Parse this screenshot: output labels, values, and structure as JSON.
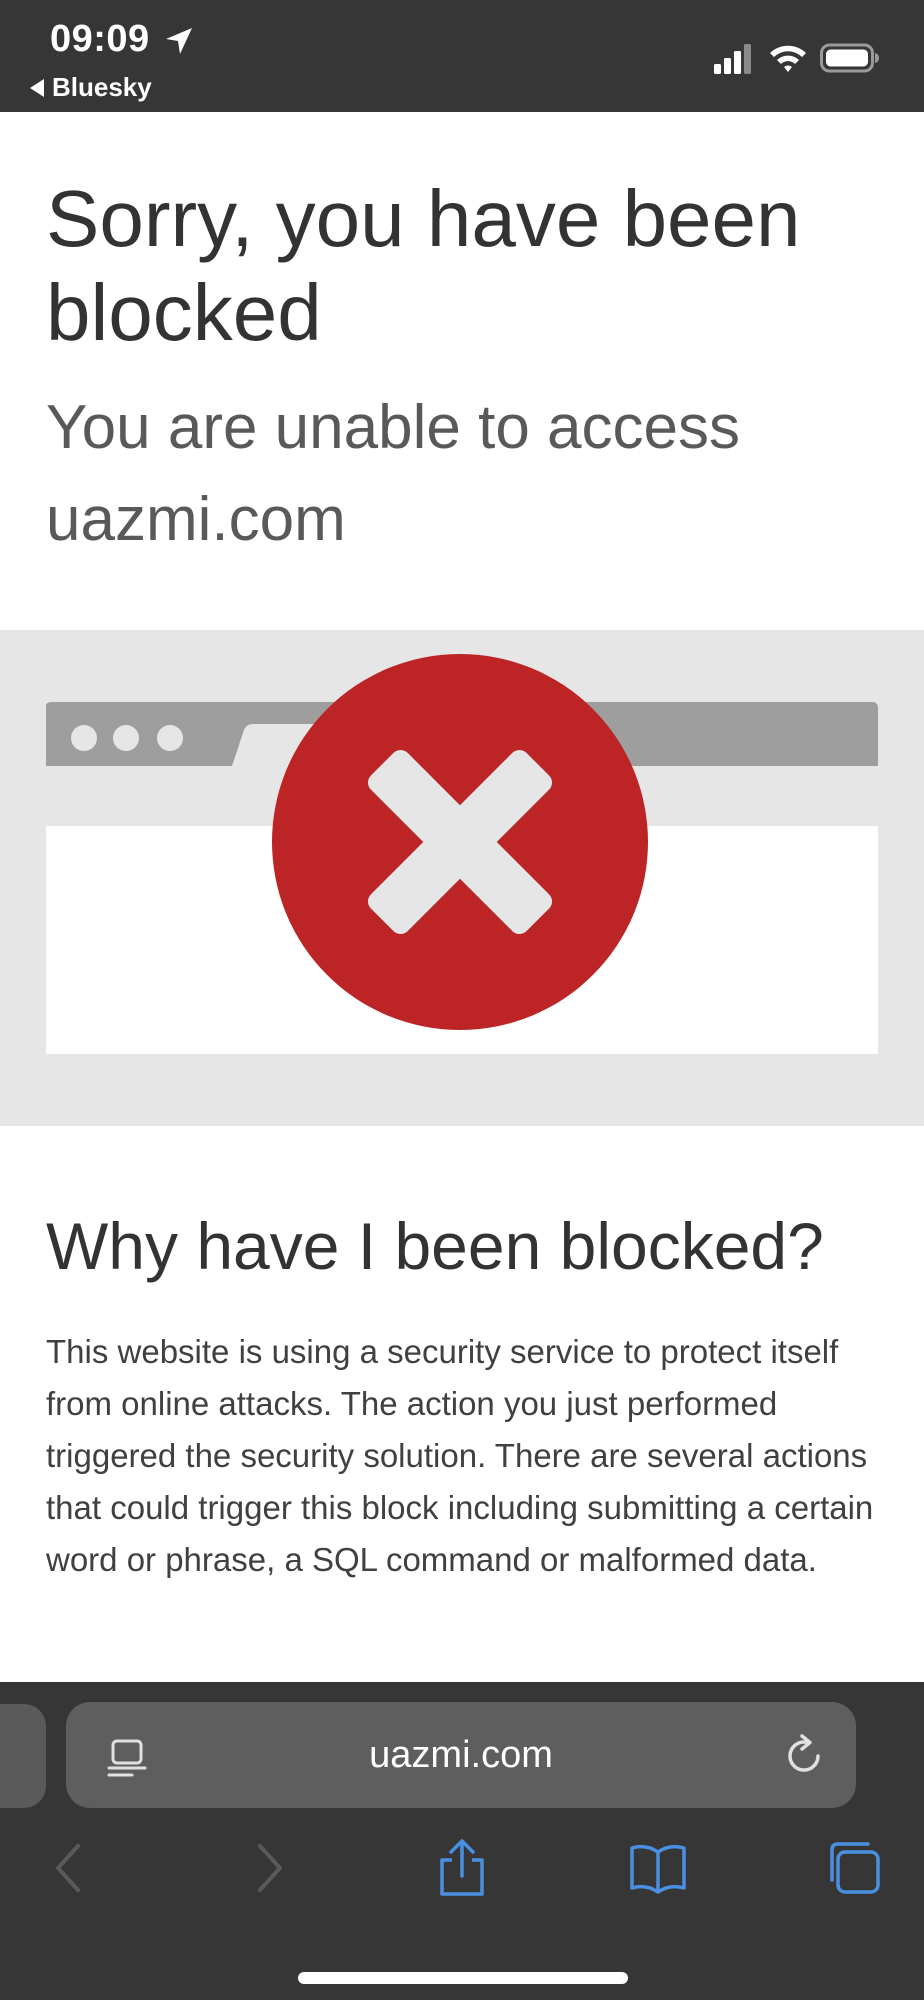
{
  "status_bar": {
    "time": "09:09",
    "back_app": "Bluesky",
    "icons": [
      "location-arrow-icon",
      "signal-icon",
      "wifi-icon",
      "battery-icon"
    ]
  },
  "hero": {
    "title": "Sorry, you have been blocked",
    "subtitle": "You are unable to access uazmi.com"
  },
  "illustration": {
    "icons": [
      "browser-window-icon",
      "blocked-x-icon"
    ],
    "colors": {
      "frame": "#9e9e9e",
      "tab": "#e6e6e6",
      "window": "#ffffff",
      "error_circle": "#bd2426",
      "x_mark": "#e6e6e6"
    }
  },
  "explanation": {
    "heading": "Why have I been blocked?",
    "body": "This website is using a security service to protect itself from online attacks. The action you just performed triggered the security solution. There are several actions that could trigger this block including submitting a certain word or phrase, a SQL command or malformed data."
  },
  "browser": {
    "address": "uazmi.com",
    "icons": [
      "reader-icon",
      "reload-icon",
      "back-icon",
      "forward-icon",
      "share-icon",
      "bookmarks-icon",
      "tabs-icon"
    ],
    "colors": {
      "chrome": "#363636",
      "pill": "#5e5e5e",
      "accent": "#4a90e2",
      "disabled": "#5a5a5a"
    }
  }
}
